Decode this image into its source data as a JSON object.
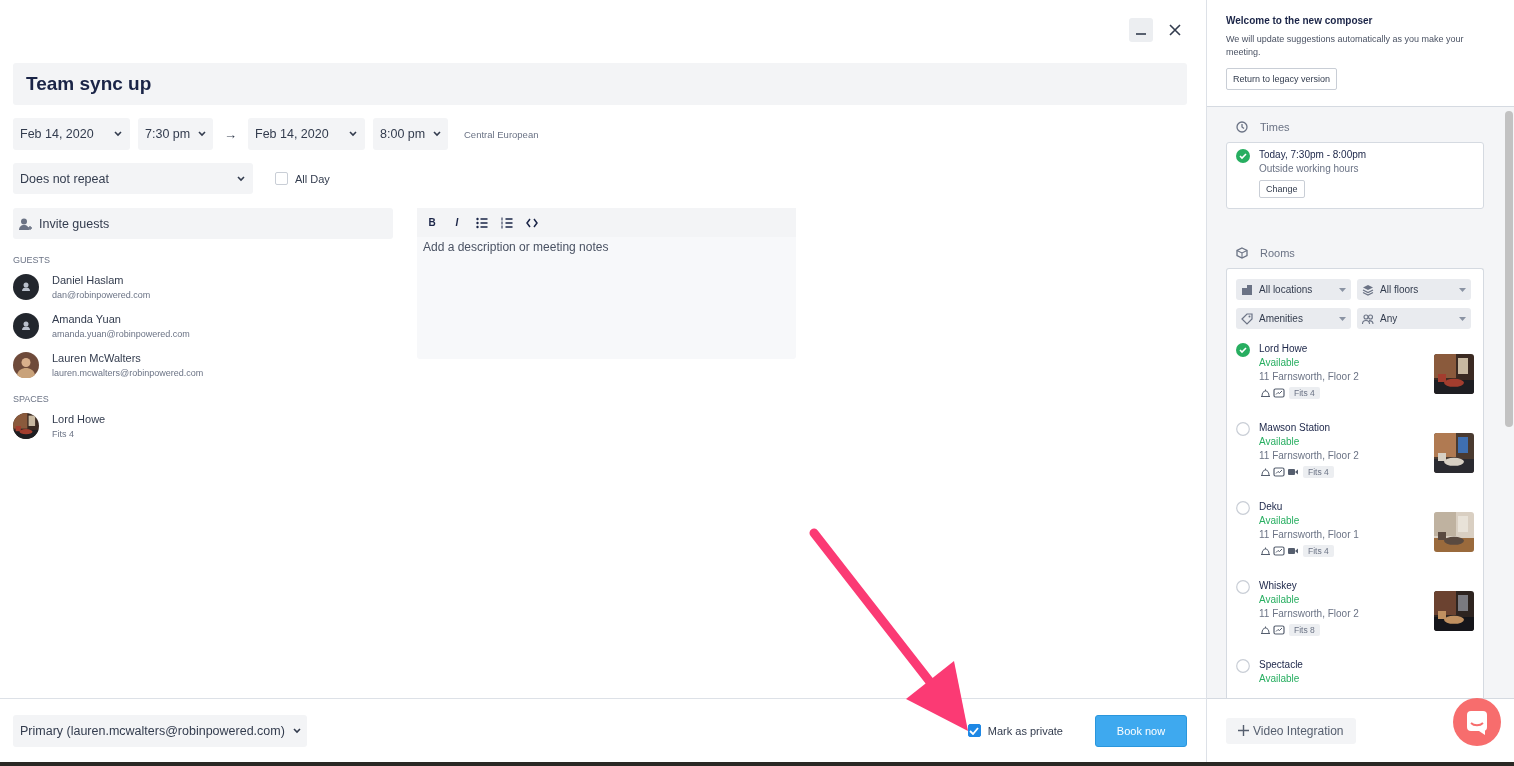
{
  "dialog": {
    "title": "Team sync up"
  },
  "when": {
    "start_date": "Feb 14, 2020",
    "start_time": "7:30 pm",
    "separator": "→",
    "end_date": "Feb 14, 2020",
    "end_time": "8:00 pm",
    "timezone": "Central European"
  },
  "repeat": "Does not repeat",
  "all_day": {
    "label": "All Day",
    "checked": false
  },
  "invite": {
    "placeholder": "Invite guests"
  },
  "editor": {
    "tools": [
      {
        "kind": "bold",
        "label": "B"
      },
      {
        "kind": "italic",
        "label": "I"
      },
      {
        "kind": "bullets"
      },
      {
        "kind": "numbers"
      },
      {
        "kind": "code"
      }
    ],
    "placeholder": "Add a description or meeting notes"
  },
  "guests": {
    "heading": "GUESTS",
    "items": [
      {
        "name": "Daniel Haslam",
        "email": "dan@robinpowered.com",
        "kind": "default"
      },
      {
        "name": "Amanda Yuan",
        "email": "amanda.yuan@robinpowered.com",
        "kind": "default"
      },
      {
        "name": "Lauren McWalters",
        "email": "lauren.mcwalters@robinpowered.com"
      }
    ]
  },
  "spaces": {
    "heading": "SPACES",
    "items": [
      {
        "name": "Lord Howe",
        "detail": "Fits 4"
      }
    ]
  },
  "footer": {
    "calendar": "Primary (lauren.mcwalters@robinpowered.com)",
    "private": {
      "label": "Mark as private",
      "checked": true
    },
    "book": "Book now"
  },
  "sidebar": {
    "welcome": {
      "title": "Welcome to the new composer",
      "text": "We will update suggestions automatically as you make your meeting.",
      "button": "Return to legacy version"
    },
    "times": {
      "heading": "Times",
      "slot": {
        "title": "Today, 7:30pm - 8:00pm",
        "subtitle": "Outside working hours",
        "button": "Change",
        "selected": true
      }
    },
    "rooms": {
      "heading": "Rooms",
      "filters": [
        {
          "kind": "building",
          "label": "All locations"
        },
        {
          "kind": "layers",
          "label": "All floors"
        },
        {
          "kind": "tag",
          "label": "Amenities"
        },
        {
          "kind": "people",
          "label": "Any"
        }
      ],
      "items": [
        {
          "name": "Lord Howe",
          "status": "Available",
          "address": "11 Farnsworth, Floor 2",
          "amenities": [
            {
              "kind": "bell"
            },
            {
              "kind": "screen"
            }
          ],
          "capacity": "Fits 4",
          "selected": true
        },
        {
          "name": "Mawson Station",
          "status": "Available",
          "address": "11 Farnsworth, Floor 2",
          "amenities": [
            {
              "kind": "bell"
            },
            {
              "kind": "screen"
            },
            {
              "kind": "video"
            }
          ],
          "capacity": "Fits 4",
          "selected": false
        },
        {
          "name": "Deku",
          "status": "Available",
          "address": "11 Farnsworth, Floor 1",
          "amenities": [
            {
              "kind": "bell"
            },
            {
              "kind": "screen"
            },
            {
              "kind": "video"
            }
          ],
          "capacity": "Fits 4",
          "selected": false
        },
        {
          "name": "Whiskey",
          "status": "Available",
          "address": "11 Farnsworth, Floor 2",
          "amenities": [
            {
              "kind": "bell"
            },
            {
              "kind": "screen"
            }
          ],
          "capacity": "Fits 8",
          "selected": false
        },
        {
          "name": "Spectacle",
          "status": "Available",
          "selected": false
        }
      ]
    },
    "video_button": "Video Integration"
  }
}
